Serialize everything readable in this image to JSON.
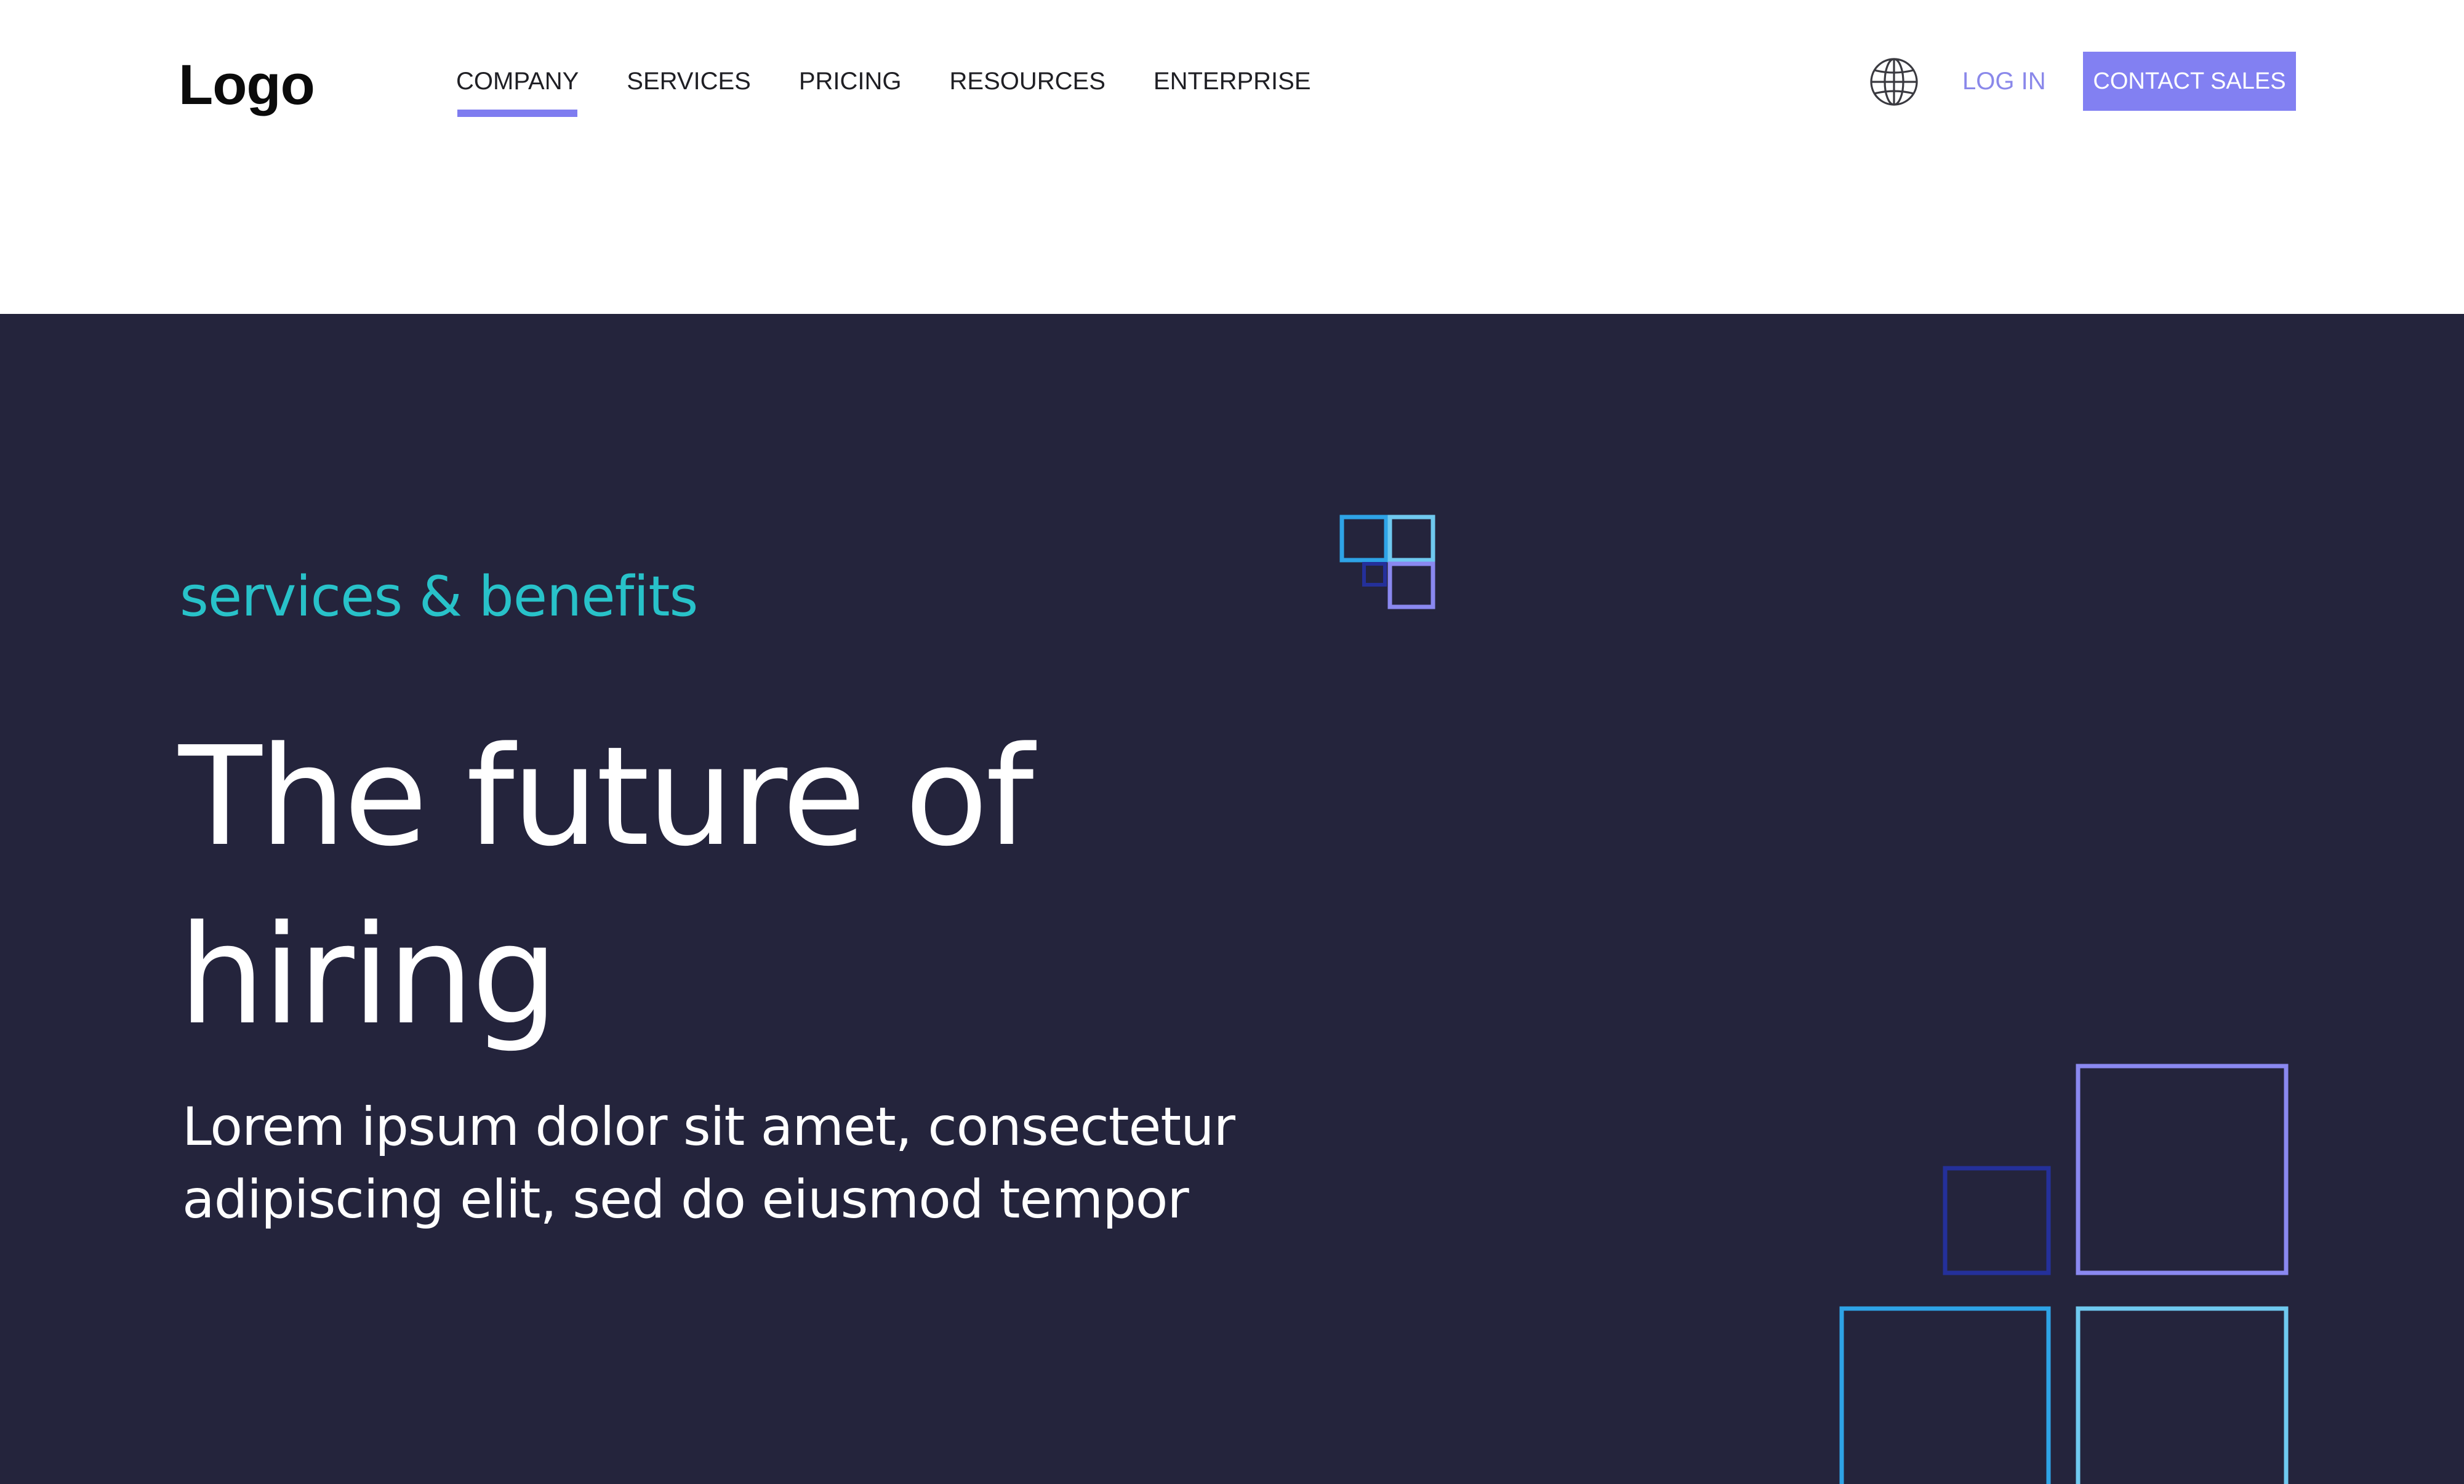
{
  "header": {
    "logo": "Logo",
    "nav": [
      {
        "label": "COMPANY",
        "active": true
      },
      {
        "label": "SERVICES",
        "active": false
      },
      {
        "label": "PRICING",
        "active": false
      },
      {
        "label": "RESOURCES",
        "active": false
      },
      {
        "label": "ENTERPRISE",
        "active": false
      }
    ],
    "language_icon": "globe-icon",
    "login_label": "LOG IN",
    "contact_label": "CONTACT SALES"
  },
  "hero": {
    "eyebrow": "services & benefits",
    "headline_lines": [
      "The future of",
      "hiring"
    ],
    "subtext_lines": [
      "Lorem ipsum dolor sit amet, consectetur",
      "adipiscing elit, sed do eiusmod tempor"
    ]
  },
  "colors": {
    "accent": "#8280f2",
    "teal": "#28c2c9",
    "hero_background": "#24243c",
    "deco_blue": "#2ea3e6",
    "deco_light_blue": "#6fc9ef",
    "deco_lavender": "#8a88f0",
    "deco_navy": "#24309a"
  }
}
